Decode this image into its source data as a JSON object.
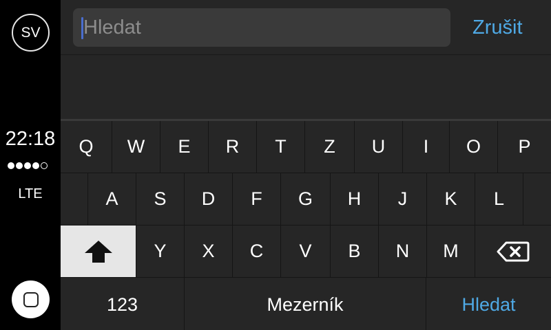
{
  "status": {
    "avatar_initials": "SV",
    "time": "22:18",
    "signal_bars": 4,
    "signal_total": 5,
    "network": "LTE"
  },
  "search": {
    "placeholder": "Hledat",
    "value": "",
    "cancel_label": "Zrušit"
  },
  "keyboard": {
    "row1": [
      "Q",
      "W",
      "E",
      "R",
      "T",
      "Z",
      "U",
      "I",
      "O",
      "P"
    ],
    "row2": [
      "A",
      "S",
      "D",
      "F",
      "G",
      "H",
      "J",
      "K",
      "L"
    ],
    "row3": [
      "Y",
      "X",
      "C",
      "V",
      "B",
      "N",
      "M"
    ],
    "numbers_label": "123",
    "space_label": "Mezerník",
    "search_label": "Hledat",
    "shift_icon": "shift-arrow-icon",
    "backspace_icon": "backspace-icon"
  },
  "colors": {
    "accent": "#4fa9e5",
    "background": "#242424",
    "shift_active": "#e6e6e6"
  }
}
